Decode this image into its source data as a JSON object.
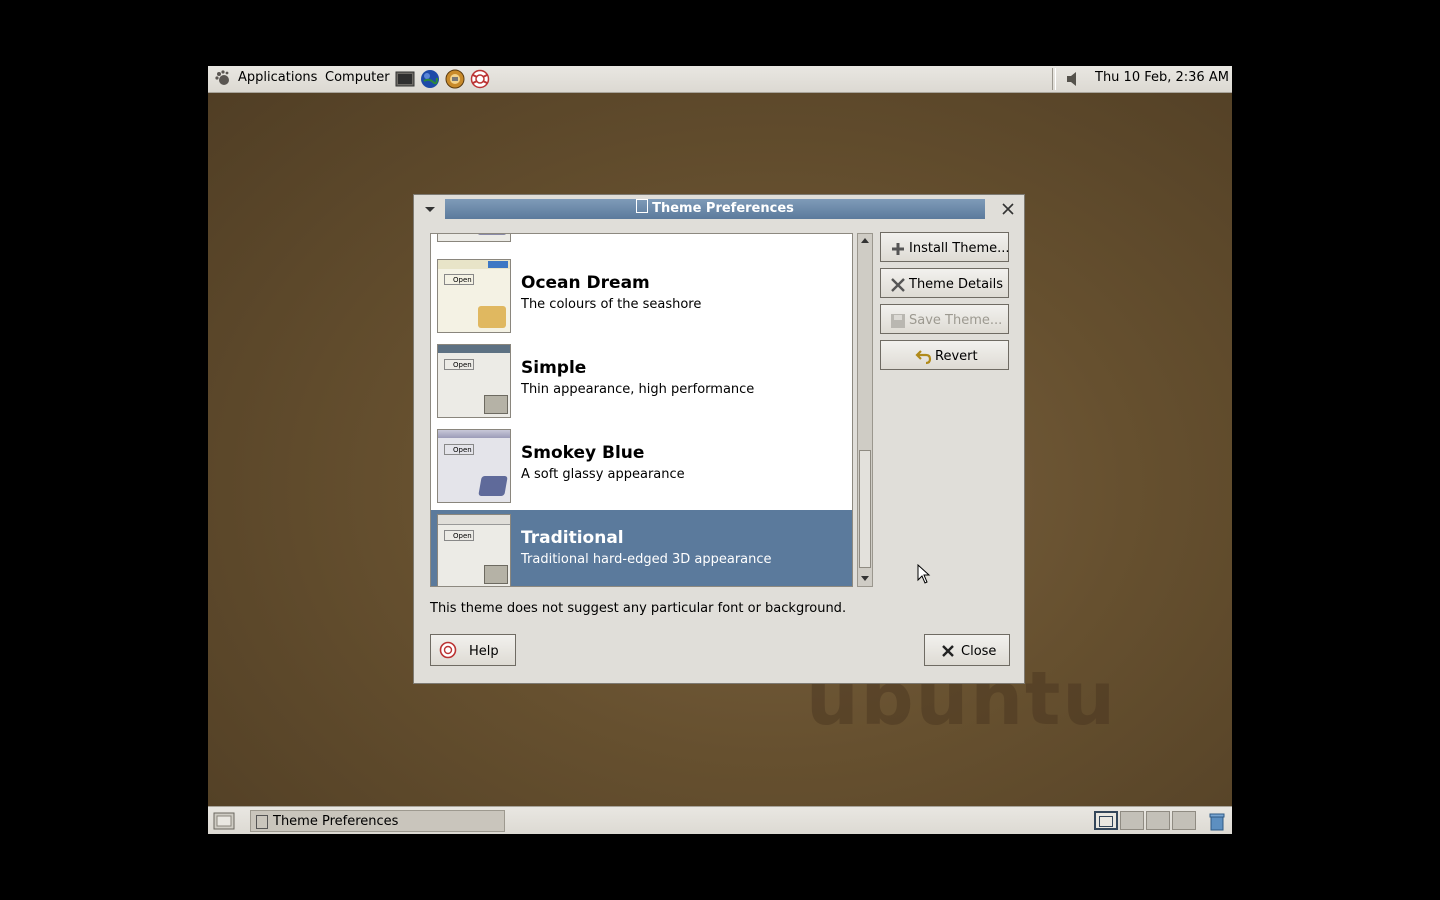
{
  "panel": {
    "applications": "Applications",
    "computer": "Computer",
    "clock": "Thu 10 Feb,  2:36 AM"
  },
  "dialog": {
    "title": "Theme Preferences",
    "themes": [
      {
        "name": "Ocean Dream",
        "desc": "The colours of the seashore",
        "selected": false
      },
      {
        "name": "Simple",
        "desc": "Thin appearance, high performance",
        "selected": false
      },
      {
        "name": "Smokey Blue",
        "desc": "A soft glassy appearance",
        "selected": false
      },
      {
        "name": "Traditional",
        "desc": "Traditional hard-edged 3D appearance",
        "selected": true
      }
    ],
    "buttons": {
      "install": "Install Theme...",
      "details": "Theme Details",
      "save": "Save Theme...",
      "revert": "Revert",
      "help": "Help",
      "close": "Close"
    },
    "note": "This theme does not suggest any particular font or background.",
    "thumb_open_label": "Open"
  },
  "taskbar": {
    "task_label": "Theme Preferences"
  },
  "watermark": "ubuntu",
  "colors": {
    "selection": "#5b7a9c",
    "titlebar": "#6a89aa",
    "desktop": "#66502f"
  }
}
